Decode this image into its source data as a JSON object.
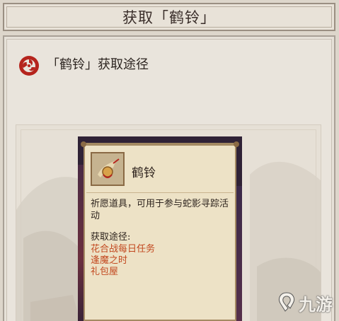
{
  "window": {
    "title": "获取「鹤铃」"
  },
  "section": {
    "title": "「鹤铃」获取途径",
    "icon": "mitsudomoe-icon"
  },
  "item": {
    "name": "鹤铃",
    "icon": "crane-bell-icon",
    "description": "祈愿道具，可用于参与蛇影寻踪活动",
    "obtain_label": "获取途径:",
    "obtain_sources": [
      "花合战每日任务",
      "逢魔之时",
      "礼包屋"
    ]
  },
  "watermark": {
    "text": "九游",
    "icon": "nine-game-logo-icon"
  },
  "colors": {
    "accent_red": "#c2481f",
    "mitsu_red": "#b5241d",
    "card_bg": "#ede2c6",
    "frame": "#9a8f82"
  }
}
